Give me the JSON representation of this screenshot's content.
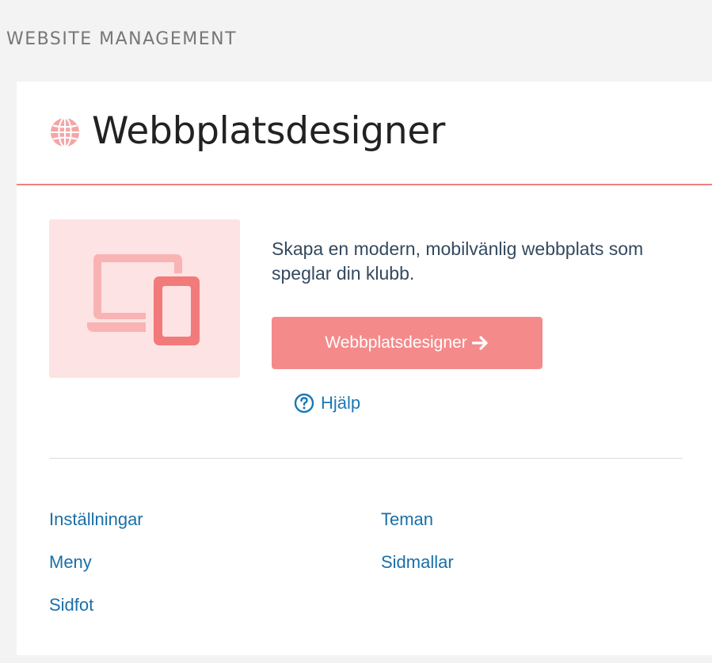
{
  "section": {
    "title": "WEBSITE MANAGEMENT"
  },
  "card": {
    "title": "Webbplatsdesigner",
    "icon": "globe-icon",
    "accent_color": "#f08080",
    "illustration_icon": "devices-icon",
    "promo_text": "Skapa en modern, mobilvänlig webbplats som speglar din klubb.",
    "cta_label": "Webbplatsdesigner",
    "cta_color": "#f58a8a",
    "help_label": "Hjälp",
    "links": {
      "settings": "Inställningar",
      "themes": "Teman",
      "menu": "Meny",
      "page_templates": "Sidmallar",
      "footer": "Sidfot"
    }
  }
}
